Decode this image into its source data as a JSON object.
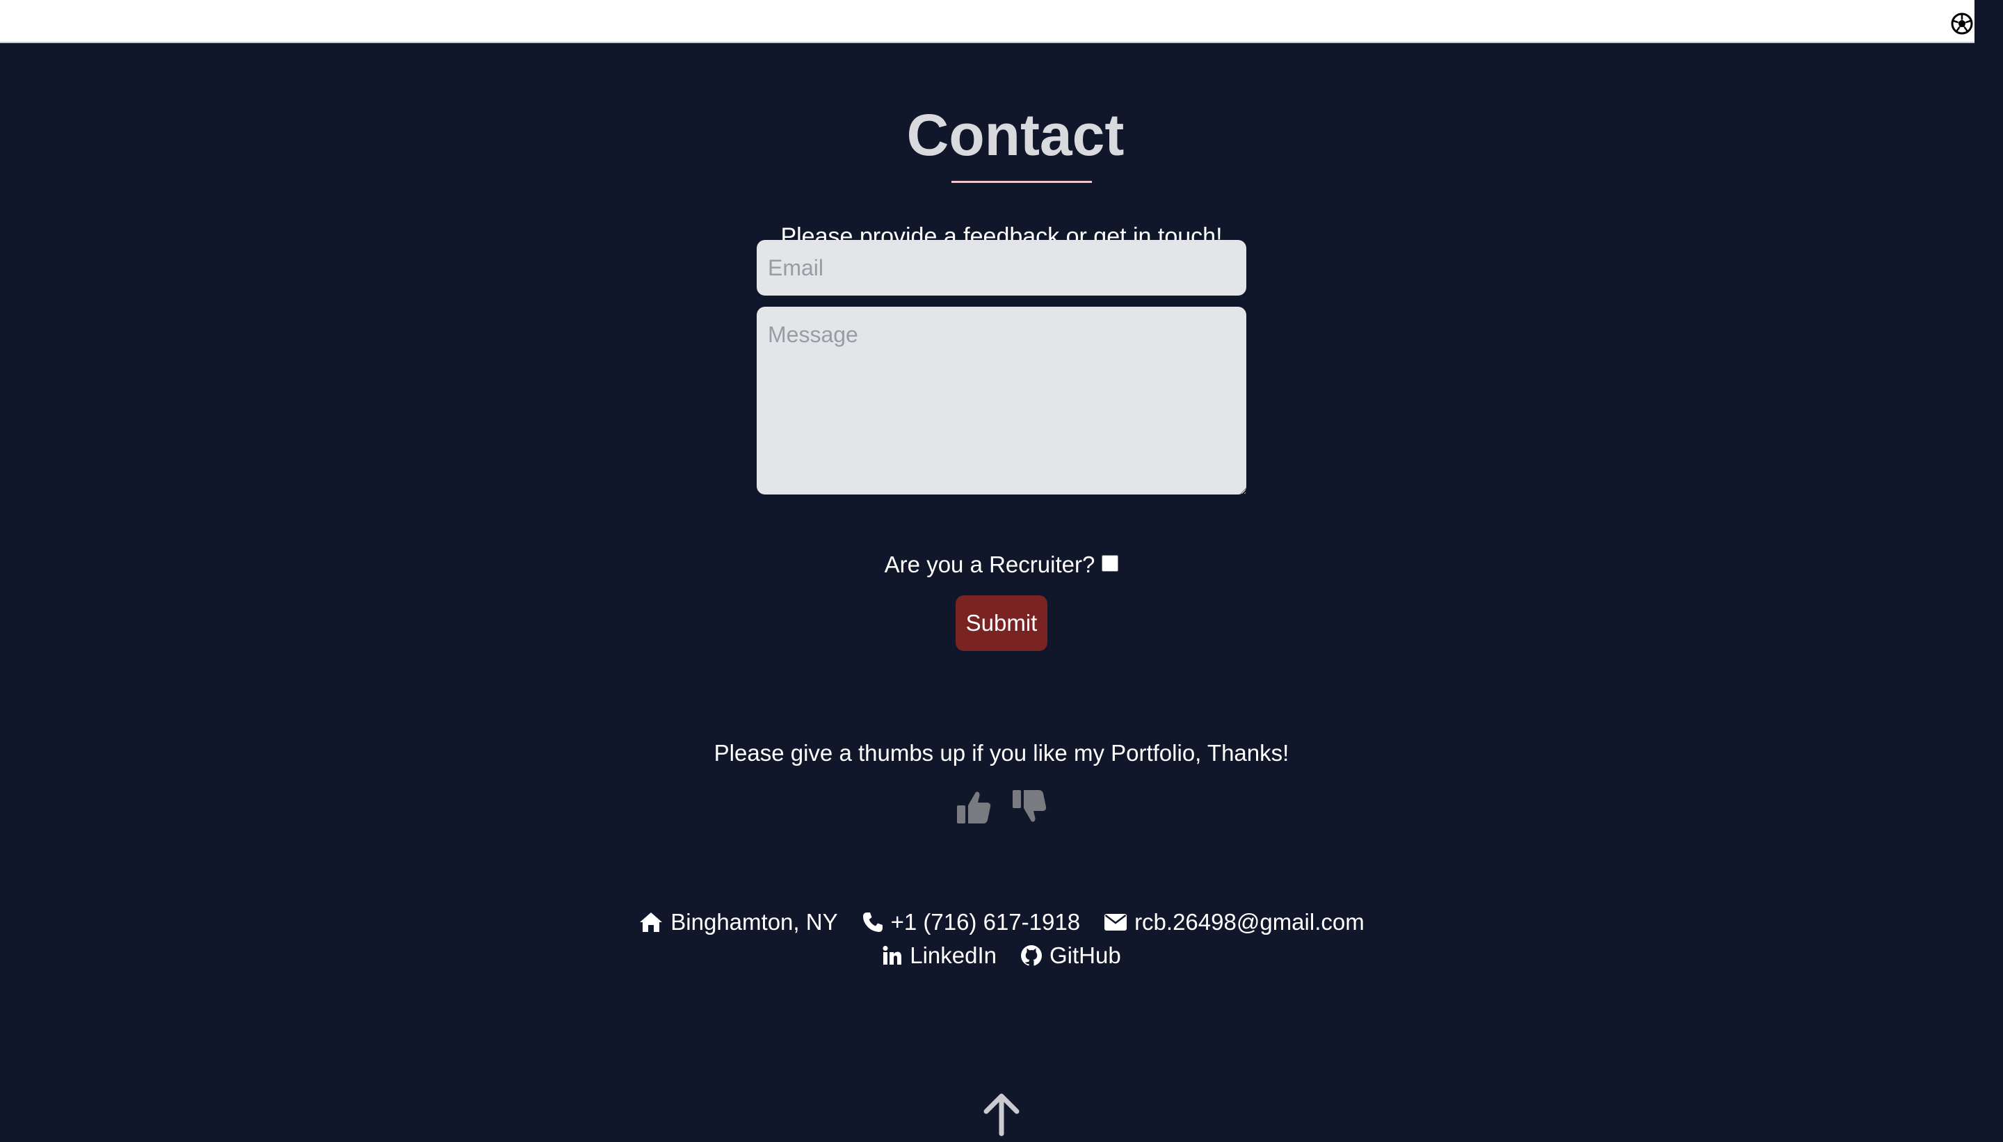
{
  "header": {
    "theme_toggle_icon": "soccer-ball-icon"
  },
  "contact": {
    "title": "Contact",
    "intro": "Please provide a feedback or get in touch!",
    "email_placeholder": "Email",
    "email_value": "",
    "message_placeholder": "Message",
    "message_value": "",
    "recruiter_label": "Are you a Recruiter?",
    "recruiter_checked": false,
    "submit_label": "Submit"
  },
  "feedback": {
    "prompt": "Please give a thumbs up if you like my Portfolio, Thanks!",
    "thumbs_up_icon": "thumbs-up-icon",
    "thumbs_down_icon": "thumbs-down-icon"
  },
  "info": {
    "location": "Binghamton, NY",
    "phone": "+1 (716) 617-1918",
    "email": "rcb.26498@gmail.com",
    "linkedin_label": "LinkedIn",
    "github_label": "GitHub"
  },
  "footer": {
    "back_to_top_icon": "arrow-up-icon"
  },
  "colors": {
    "background": "#11172a",
    "title": "#d9dade",
    "underline": "#f2c4cf",
    "input_bg": "#e4e5e9",
    "submit_bg": "#7a2323",
    "vote_icon": "#7a7b80",
    "text": "#ffffff"
  }
}
